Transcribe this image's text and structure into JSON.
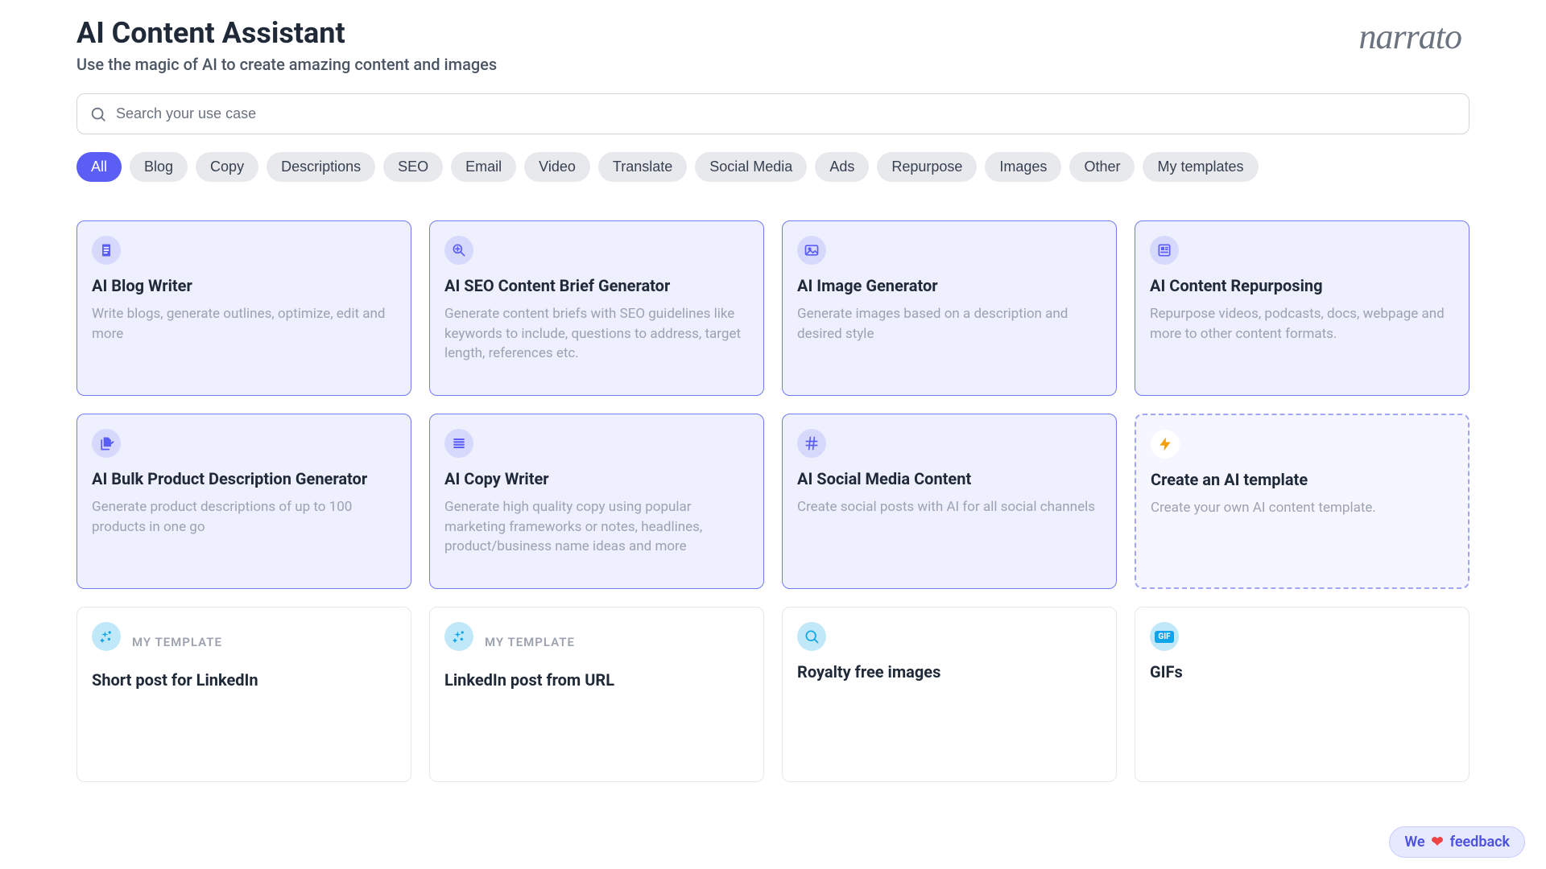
{
  "header": {
    "title": "AI Content Assistant",
    "subtitle": "Use the magic of AI to create amazing content and images",
    "logo": "narrato"
  },
  "search": {
    "placeholder": "Search your use case"
  },
  "chips": [
    {
      "label": "All",
      "active": true
    },
    {
      "label": "Blog",
      "active": false
    },
    {
      "label": "Copy",
      "active": false
    },
    {
      "label": "Descriptions",
      "active": false
    },
    {
      "label": "SEO",
      "active": false
    },
    {
      "label": "Email",
      "active": false
    },
    {
      "label": "Video",
      "active": false
    },
    {
      "label": "Translate",
      "active": false
    },
    {
      "label": "Social Media",
      "active": false
    },
    {
      "label": "Ads",
      "active": false
    },
    {
      "label": "Repurpose",
      "active": false
    },
    {
      "label": "Images",
      "active": false
    },
    {
      "label": "Other",
      "active": false
    },
    {
      "label": "My templates",
      "active": false
    }
  ],
  "cards": [
    {
      "icon": "document-icon",
      "title": "AI Blog Writer",
      "desc": "Write blogs, generate outlines, optimize, edit and more",
      "style": "normal"
    },
    {
      "icon": "magnifier-plus-icon",
      "title": "AI SEO Content Brief Generator",
      "desc": "Generate content briefs with SEO guidelines like keywords to include, questions to address, target length, references etc.",
      "style": "normal"
    },
    {
      "icon": "image-icon",
      "title": "AI Image Generator",
      "desc": "Generate images based on a description and desired style",
      "style": "normal"
    },
    {
      "icon": "newspaper-icon",
      "title": "AI Content Repurposing",
      "desc": "Repurpose videos, podcasts, docs, webpage and more to other content formats.",
      "style": "normal"
    },
    {
      "icon": "files-icon",
      "title": "AI Bulk Product Description Generator",
      "desc": "Generate product descriptions of up to 100 products in one go",
      "style": "normal"
    },
    {
      "icon": "lines-icon",
      "title": "AI Copy Writer",
      "desc": "Generate high quality copy using popular marketing frameworks or notes, headlines, product/business name ideas and more",
      "style": "normal"
    },
    {
      "icon": "hash-icon",
      "title": "AI Social Media Content",
      "desc": "Create social posts with AI for all social channels",
      "style": "normal"
    },
    {
      "icon": "bolt-icon",
      "title": "Create an AI template",
      "desc": "Create your own AI content template.",
      "style": "dashed"
    },
    {
      "icon": "sparkle-icon",
      "badge": "MY TEMPLATE",
      "title": "Short post for LinkedIn",
      "desc": "",
      "style": "white"
    },
    {
      "icon": "sparkle-icon",
      "badge": "MY TEMPLATE",
      "title": "LinkedIn post from URL",
      "desc": "",
      "style": "white"
    },
    {
      "icon": "search-icon",
      "title": "Royalty free images",
      "desc": "",
      "style": "white"
    },
    {
      "icon": "gif-icon",
      "title": "GIFs",
      "desc": "",
      "style": "white"
    }
  ],
  "feedback": {
    "we": "We",
    "label": "feedback"
  }
}
